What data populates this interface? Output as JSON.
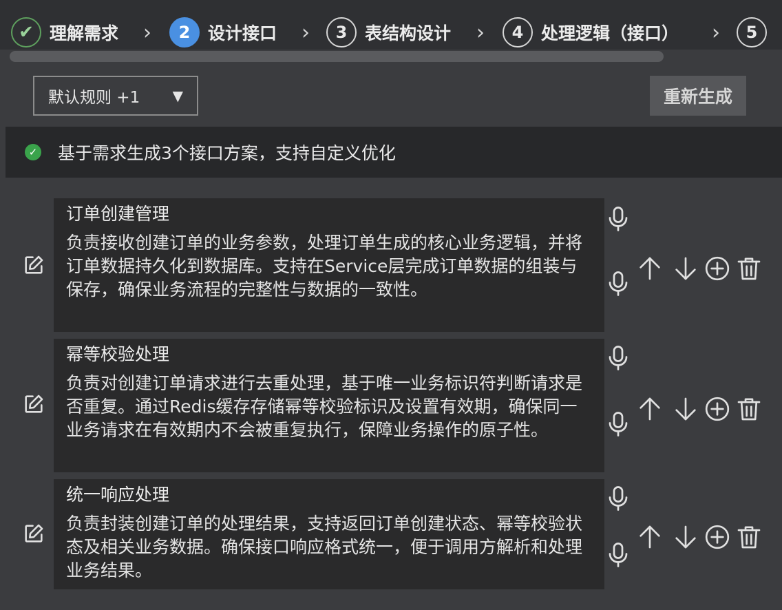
{
  "stepper": {
    "steps": [
      {
        "number": "✔",
        "label": "理解需求",
        "state": "done"
      },
      {
        "number": "2",
        "label": "设计接口",
        "state": "active"
      },
      {
        "number": "3",
        "label": "表结构设计",
        "state": "pending"
      },
      {
        "number": "4",
        "label": "处理逻辑（接口）",
        "state": "pending"
      },
      {
        "number": "5",
        "label": "",
        "state": "pending"
      }
    ]
  },
  "toolbar": {
    "rules_select": "默认规则 +1",
    "regenerate_label": "重新生成"
  },
  "status": {
    "text": "基于需求生成3个接口方案，支持自定义优化",
    "color": "#3aa34b"
  },
  "interfaces": [
    {
      "title": "订单创建管理",
      "description": "负责接收创建订单的业务参数，处理订单生成的核心业务逻辑，并将订单数据持久化到数据库。支持在Service层完成订单数据的组装与保存，确保业务流程的完整性与数据的一致性。"
    },
    {
      "title": "幂等校验处理",
      "description": "负责对创建订单请求进行去重处理，基于唯一业务标识符判断请求是否重复。通过Redis缓存存储幂等校验标识及设置有效期，确保同一业务请求在有效期内不会被重复执行，保障业务操作的原子性。"
    },
    {
      "title": "统一响应处理",
      "description": "负责封装创建订单的处理结果，支持返回订单创建状态、幂等校验状态及相关业务数据。确保接口响应格式统一，便于调用方解析和处理业务结果。"
    }
  ],
  "colors": {
    "accent": "#4a90e2",
    "done": "#5ea05e",
    "card_bg": "#2a2a2b",
    "page_bg": "#3b3c3f"
  }
}
